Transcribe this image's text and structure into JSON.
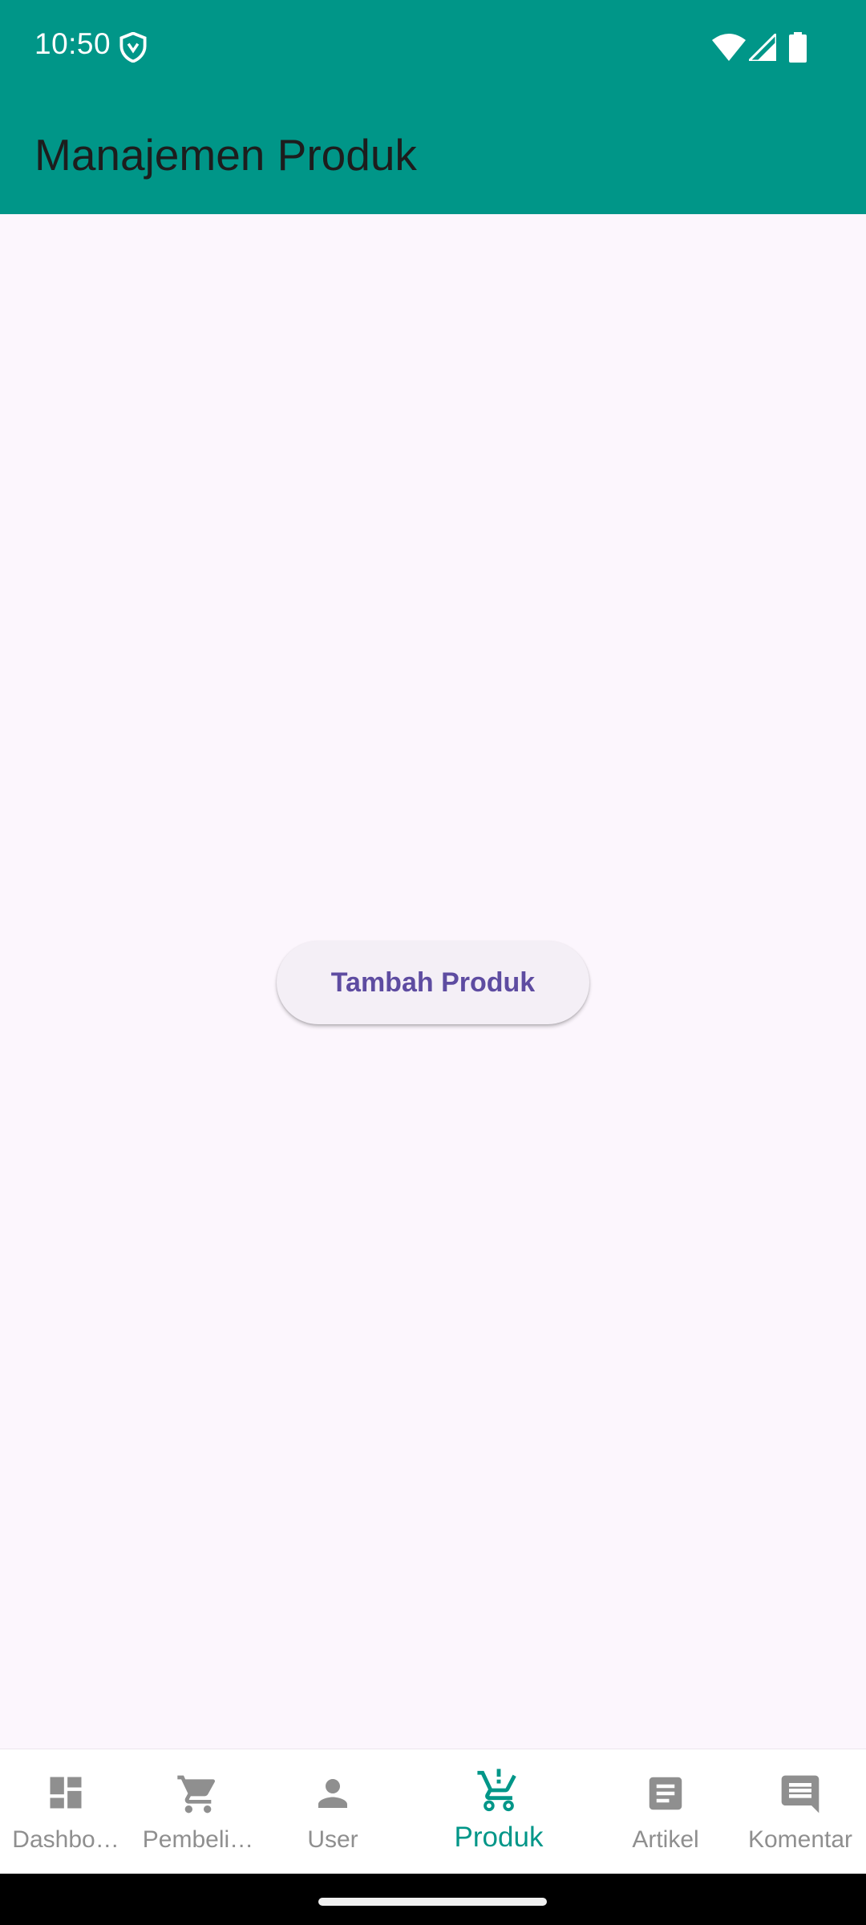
{
  "status_bar": {
    "time": "10:50"
  },
  "app_bar": {
    "title": "Manajemen Produk"
  },
  "main": {
    "add_button_label": "Tambah Produk"
  },
  "bottom_nav": {
    "items": [
      {
        "label": "Dashbo…",
        "icon": "dashboard-icon",
        "active": false
      },
      {
        "label": "Pembeli…",
        "icon": "cart-icon",
        "active": false
      },
      {
        "label": "User",
        "icon": "person-icon",
        "active": false
      },
      {
        "label": "Produk",
        "icon": "cart-add-icon",
        "active": true
      },
      {
        "label": "Artikel",
        "icon": "article-icon",
        "active": false
      },
      {
        "label": "Komentar",
        "icon": "comment-icon",
        "active": false
      }
    ]
  },
  "colors": {
    "primary": "#009688",
    "background": "#FCF6FD",
    "button_text": "#5E4CA1",
    "inactive": "#8F8F8F"
  }
}
